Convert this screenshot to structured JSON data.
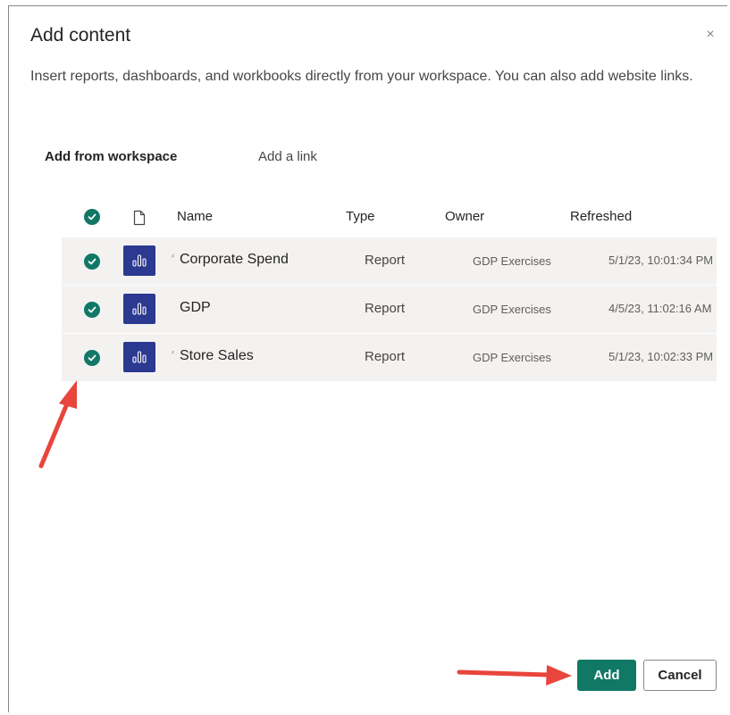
{
  "dialog": {
    "title": "Add content",
    "close_glyph": "×",
    "description": "Insert reports, dashboards, and workbooks directly from your workspace. You can also add website links."
  },
  "tabs": [
    {
      "label": "Add from workspace",
      "active": true
    },
    {
      "label": "Add a link",
      "active": false
    }
  ],
  "table": {
    "headers": {
      "name": "Name",
      "type": "Type",
      "owner": "Owner",
      "refreshed": "Refreshed"
    },
    "rows": [
      {
        "endorse": "⸗",
        "name": "Corporate Spend",
        "type": "Report",
        "owner": "GDP Exercises",
        "refreshed": "5/1/23, 10:01:34 PM",
        "selected": true
      },
      {
        "endorse": "",
        "name": "GDP",
        "type": "Report",
        "owner": "GDP Exercises",
        "refreshed": "4/5/23, 11:02:16 AM",
        "selected": true
      },
      {
        "endorse": "⸗",
        "name": "Store Sales",
        "type": "Report",
        "owner": "GDP Exercises",
        "refreshed": "5/1/23, 10:02:33 PM",
        "selected": true
      }
    ]
  },
  "buttons": {
    "add": "Add",
    "cancel": "Cancel"
  },
  "colors": {
    "accent": "#117865",
    "report_icon": "#2b3990",
    "annotation_arrow": "#e8453c"
  },
  "icons": {
    "checkmark": "checkmark-circle-icon",
    "file": "file-icon",
    "report": "report-chart-icon",
    "close": "close-icon"
  }
}
